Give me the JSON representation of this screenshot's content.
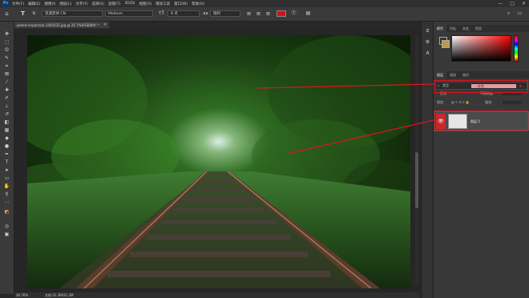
{
  "app": {
    "logo_text": "Ps",
    "menu": [
      "文件(F)",
      "编辑(E)",
      "图像(I)",
      "图层(L)",
      "文字(Y)",
      "选择(S)",
      "滤镜(T)",
      "3D(D)",
      "视图(V)",
      "增效工具",
      "窗口(W)",
      "帮助(H)"
    ],
    "window_controls": [
      "—",
      "□",
      "✕"
    ]
  },
  "options": {
    "font_family": "思源黑体 CN",
    "font_style": "Medium",
    "font_size": "8 点",
    "antialias": "锐利",
    "text_color": "#d80f17"
  },
  "document": {
    "tab_title": "pexels-vnparraco-1445632.jpg @ 26.7%(RGB/8#) *",
    "tab_close": "×"
  },
  "status": {
    "zoom": "26.76%",
    "doc_info": "文档:31.3M/31.3M"
  },
  "panels": {
    "color_tabs": [
      "颜色",
      "色板",
      "渐变",
      "图案"
    ],
    "layer_tabs": [
      "图层",
      "通道",
      "路径"
    ],
    "filter_kind": "类型",
    "filter_value": "红色",
    "blend_mode": "正常",
    "opacity_label": "不透明度:",
    "lock_label": "锁定:",
    "fill_label": "填充:",
    "layer_name": "图层 0"
  },
  "colors": {
    "accent_red": "#e0141c",
    "layer_visibility_highlight": "#c8292d"
  },
  "icons": [
    "move-icon",
    "marquee-icon",
    "lasso-icon",
    "quick-select-icon",
    "crop-icon",
    "frame-icon",
    "eyedropper-icon",
    "healing-icon",
    "brush-icon",
    "stamp-icon",
    "history-brush-icon",
    "eraser-icon",
    "gradient-icon",
    "blur-icon",
    "dodge-icon",
    "pen-icon",
    "type-icon",
    "path-select-icon",
    "rectangle-icon",
    "hand-icon",
    "zoom-icon",
    "edit-toolbar-icon",
    "foreground-background-icon",
    "quick-mask-icon",
    "screen-mode-icon",
    "eye-icon"
  ]
}
